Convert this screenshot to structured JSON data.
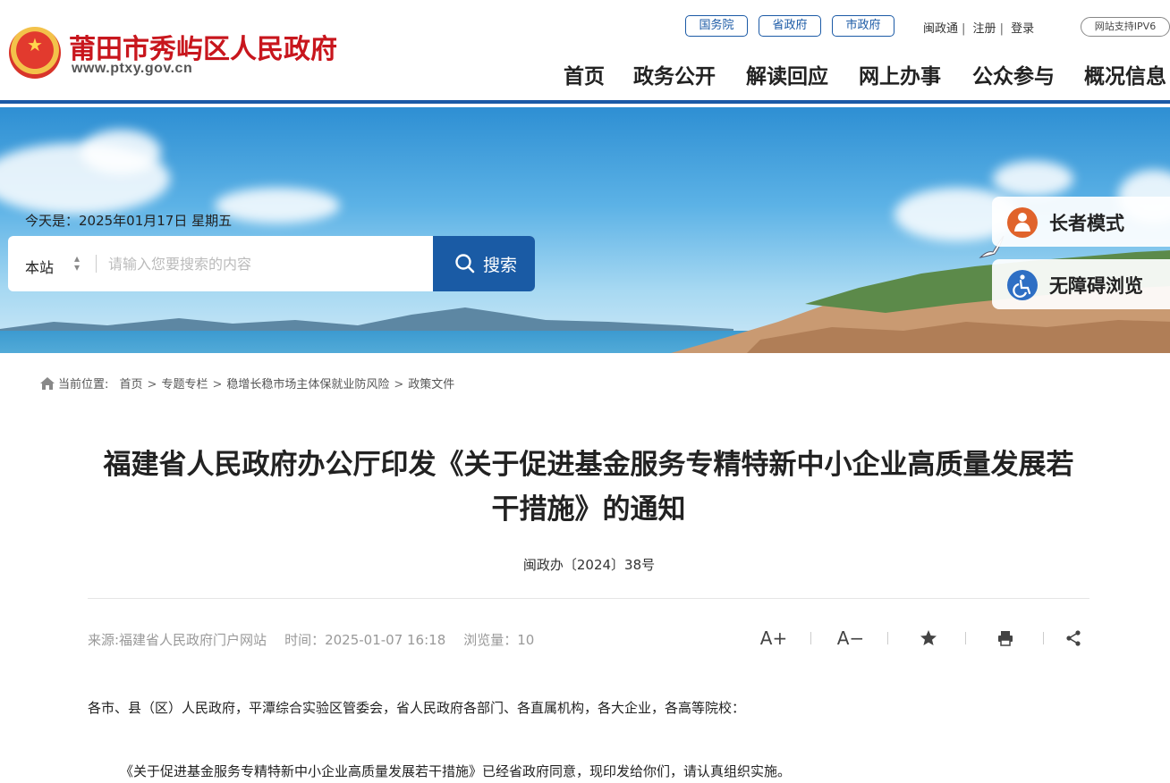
{
  "header": {
    "site_title": "莆田市秀屿区人民政府",
    "site_url": "www.ptxy.gov.cn",
    "gov_links": [
      "国务院",
      "省政府",
      "市政府"
    ],
    "util_links": [
      "闽政通",
      "注册",
      "登录"
    ],
    "ipv6_badge": "网站支持IPV6",
    "nav": [
      "首页",
      "政务公开",
      "解读回应",
      "网上办事",
      "公众参与",
      "概况信息"
    ]
  },
  "banner": {
    "today": "今天是：2025年01月17日 星期五",
    "search": {
      "scope": "本站",
      "placeholder": "请输入您要搜索的内容",
      "button": "搜索"
    },
    "side_buttons": {
      "elder": "长者模式",
      "accessible": "无障碍浏览"
    },
    "colors": {
      "search_button": "#1a5ba5",
      "elder_icon": "#e0632b",
      "accessible_icon": "#2e6fc4"
    }
  },
  "breadcrumb": {
    "label": "当前位置:",
    "items": [
      "首页",
      "专题专栏",
      "稳增长稳市场主体保就业防风险",
      "政策文件"
    ]
  },
  "article": {
    "title_line1": "福建省人民政府办公厅印发《关于促进基金服务专精特新中小企业高质量发展若",
    "title_line2": "干措施》的通知",
    "doc_number": "闽政办〔2024〕38号",
    "meta": {
      "source": "来源:福建省人民政府门户网站",
      "time": "时间：2025-01-07 16:18",
      "views": "浏览量：10"
    },
    "tools": {
      "font_up": "A+",
      "font_down": "A−",
      "favorite_icon": "star-icon",
      "print_icon": "printer-icon",
      "share_icon": "share-icon"
    },
    "salutation": "各市、县（区）人民政府，平潭综合实验区管委会，省人民政府各部门、各直属机构，各大企业，各高等院校：",
    "body_1": "《关于促进基金服务专精特新中小企业高质量发展若干措施》已经省政府同意，现印发给你们，请认真组织实施。"
  }
}
